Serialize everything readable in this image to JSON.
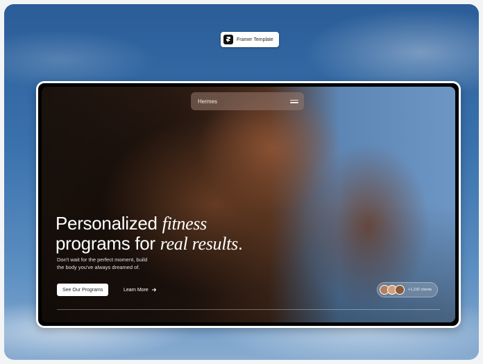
{
  "badge": {
    "label": "Framer Template",
    "icon": "framer-logo-icon"
  },
  "nav": {
    "brand": "Hermes",
    "menu_icon": "hamburger-menu-icon"
  },
  "hero": {
    "line1_plain": "Personalized ",
    "line1_italic": "fitness",
    "line2_plain": "programs for ",
    "line2_italic": "real results",
    "line2_end": ".",
    "subtext_line1": "Don't wait for the perfect moment, build",
    "subtext_line2": "the body you've always dreamed of.",
    "primary_cta": "See Our Programs",
    "secondary_cta": "Learn More",
    "secondary_cta_icon": "arrow-right-icon"
  },
  "social_proof": {
    "text": "+1,232 clients",
    "avatar_colors": [
      "#b08060",
      "#d4a07a",
      "#8a5a3c"
    ]
  },
  "colors": {
    "accent": "#ffffff",
    "sky": "#3a72ad"
  }
}
